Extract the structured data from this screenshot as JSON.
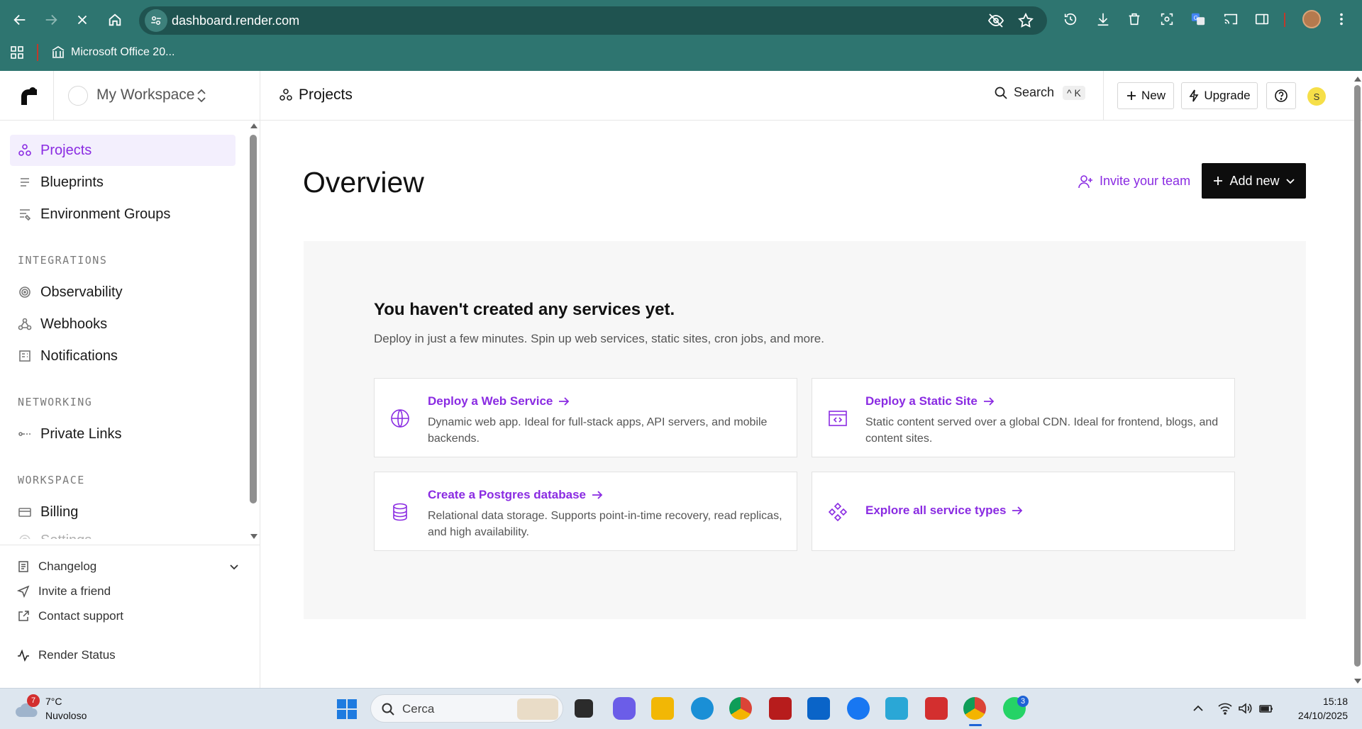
{
  "browser": {
    "url": "dashboard.render.com",
    "bookmark_label": "Microsoft Office 20...",
    "theme_color": "#2e7570"
  },
  "app": {
    "accent_color": "#8a2be2",
    "workspace_name": "My Workspace",
    "breadcrumb": "Projects",
    "search_label": "Search",
    "search_shortcut": "^ K",
    "new_label": "New",
    "upgrade_label": "Upgrade",
    "user_initial": "S"
  },
  "sidebar": {
    "items": [
      {
        "label": "Projects",
        "icon": "projects-icon",
        "active": true
      },
      {
        "label": "Blueprints",
        "icon": "blueprints-icon"
      },
      {
        "label": "Environment Groups",
        "icon": "env-groups-icon"
      }
    ],
    "sections": [
      {
        "title": "INTEGRATIONS",
        "items": [
          {
            "label": "Observability",
            "icon": "observability-icon"
          },
          {
            "label": "Webhooks",
            "icon": "webhooks-icon"
          },
          {
            "label": "Notifications",
            "icon": "notifications-icon"
          }
        ]
      },
      {
        "title": "NETWORKING",
        "items": [
          {
            "label": "Private Links",
            "icon": "private-links-icon"
          }
        ]
      },
      {
        "title": "WORKSPACE",
        "items": [
          {
            "label": "Billing",
            "icon": "billing-icon"
          },
          {
            "label": "Settings",
            "icon": "settings-icon"
          }
        ]
      }
    ],
    "bottom": [
      {
        "label": "Changelog",
        "icon": "changelog-icon"
      },
      {
        "label": "Invite a friend",
        "icon": "send-icon"
      },
      {
        "label": "Contact support",
        "icon": "external-link-icon"
      },
      {
        "label": "Render Status",
        "icon": "activity-icon"
      }
    ]
  },
  "main": {
    "title": "Overview",
    "invite_label": "Invite your team",
    "add_new_label": "Add new",
    "empty_title": "You haven't created any services yet.",
    "empty_subtitle": "Deploy in just a few minutes. Spin up web services, static sites, cron jobs, and more.",
    "cards": [
      {
        "title": "Deploy a Web Service",
        "desc": "Dynamic web app. Ideal for full-stack apps, API servers, and mobile backends.",
        "icon": "globe-icon"
      },
      {
        "title": "Deploy a Static Site",
        "desc": "Static content served over a global CDN. Ideal for frontend, blogs, and content sites.",
        "icon": "static-site-icon"
      },
      {
        "title": "Create a Postgres database",
        "desc": "Relational data storage. Supports point-in-time recovery, read replicas, and high availability.",
        "icon": "database-icon"
      },
      {
        "title": "Explore all service types",
        "desc": "",
        "icon": "services-icon"
      }
    ]
  },
  "taskbar": {
    "weather_badge": "7",
    "temperature": "7°C",
    "condition": "Nuvoloso",
    "search_placeholder": "Cerca",
    "whatsapp_badge": "3",
    "time": "15:18",
    "date": "24/10/2025"
  }
}
